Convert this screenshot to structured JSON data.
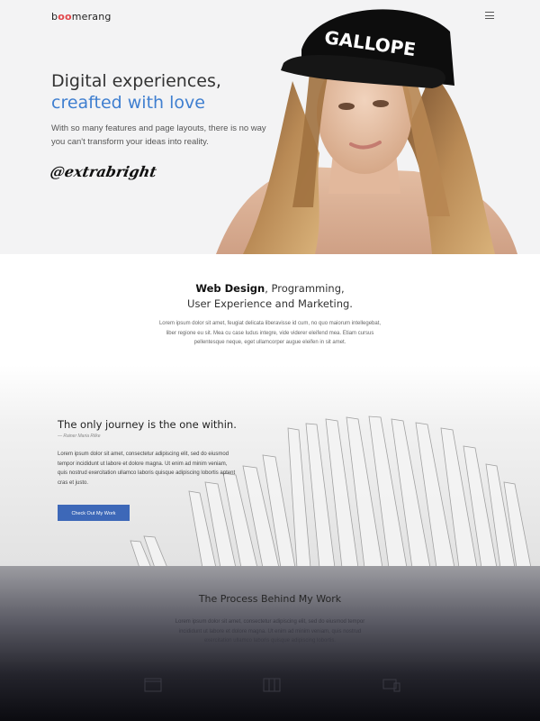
{
  "header": {
    "logo_prefix": "b",
    "logo_oo": "oo",
    "logo_suffix": "merang",
    "menu_icon": "hamburger-menu-icon"
  },
  "hero": {
    "title_line1": "Digital experiences,",
    "title_line2": "creafted with love",
    "lead": "With so many features and page layouts, there is no way you can't transform your ideas into reality.",
    "signature": "@extrabright",
    "cap_text": "GALLOPE",
    "accent_color": "#3f7fd0"
  },
  "services": {
    "heading_bold": "Web Design",
    "heading_rest1": ", Programming,",
    "heading_line2": "User Experience and Marketing.",
    "body": "Lorem ipsum dolor sit amet, feugiat delicata liberavisse id cum, no quo maiorum intellegebat, liber regione eu sit. Mea cu case ludus integre, vide viderer eleifend mea. Etiam cursus pellentesque neque, eget ullamcorper augue eleifen in sit amet."
  },
  "quote": {
    "title": "The only journey is the one within.",
    "author": "— Rainer Maria Rilke",
    "body": "Lorem ipsum dolor sit amet, consectetur adipiscing elit, sed do eiusmod tempor incididunt ut labore et dolore magna. Ut enim ad minim veniam, quis nostrud exercitation ullamco laboris quisque adipiscing lobortis aptent cras et justo.",
    "button_label": "Check Out My Work",
    "button_color": "#3d68b8"
  },
  "process": {
    "title": "The Process Behind My Work",
    "body": "Lorem ipsum dolor sit amet, consectetur adipiscing elit, sed do eiusmod tempor incididunt ut labore et dolore magna. Ut enim ad minim veniam, quis nostrud exercitation ullamco laboris quisque adipiscing lobortis.",
    "icons": [
      "browser-window-icon",
      "columns-layout-icon",
      "devices-icon"
    ]
  }
}
